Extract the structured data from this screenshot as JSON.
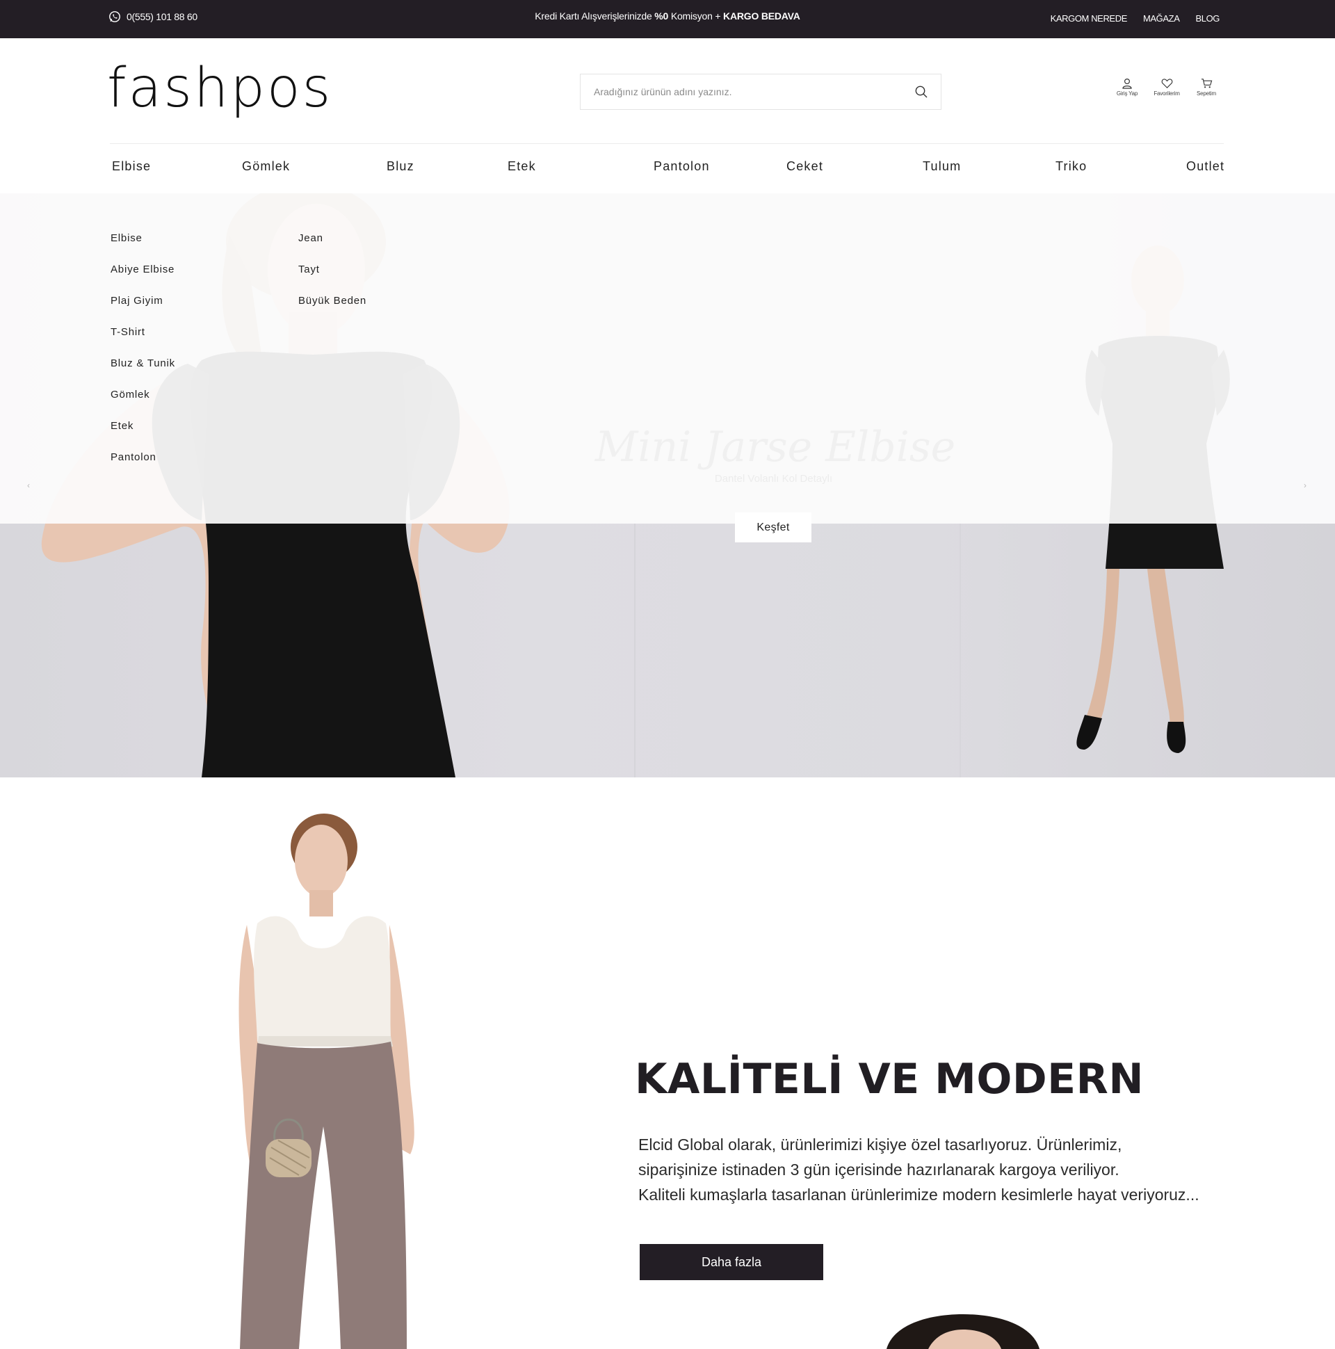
{
  "topbar": {
    "phone": "0(555) 101 88 60",
    "promo_prefix": "Kredi Kartı Alışverişlerinizde ",
    "promo_rate": "%0",
    "promo_mid": " Komisyon + ",
    "promo_cargo": "KARGO BEDAVA",
    "links": [
      "KARGOM NEREDE",
      "MAĞAZA",
      "BLOG"
    ]
  },
  "header": {
    "logo": "fashpos",
    "search_placeholder": "Aradığınız ürünün adını yazınız.",
    "user_links": [
      "Giriş Yap",
      "Favorilerim",
      "Sepetim"
    ]
  },
  "nav": [
    "Elbise",
    "Gömlek",
    "Bluz",
    "Etek",
    "Pantolon",
    "Ceket",
    "Tulum",
    "Triko",
    "Outlet"
  ],
  "dropdown": {
    "col1": [
      "Elbise",
      "Abiye Elbise",
      "Plaj Giyim",
      "T-Shirt",
      "Bluz & Tunik",
      "Gömlek",
      "Etek",
      "Pantolon"
    ],
    "col2": [
      "Jean",
      "Tayt",
      "Büyük Beden"
    ]
  },
  "hero": {
    "title": "Mini Jarse Elbise",
    "subtitle": "Dantel Volanlı Kol Detaylı",
    "cta": "Keşfet",
    "prev": "‹",
    "next": "›"
  },
  "about": {
    "title": "KALİTELİ VE MODERN",
    "lines": [
      "Elcid Global olarak, ürünlerimizi kişiye özel tasarlıyoruz. Ürünlerimiz,",
      "siparişinize istinaden 3 gün içerisinde hazırlanarak kargoya veriliyor.",
      "Kaliteli kumaşlarla tasarlanan ürünlerimize modern kesimlerle hayat veriyoruz..."
    ],
    "button": "Daha fazla"
  },
  "colors": {
    "dark": "#231e25",
    "hero_bg": "#dcdbe0",
    "white": "#ffffff"
  },
  "icons": [
    "whatsapp-icon",
    "search-icon",
    "user-icon",
    "heart-icon",
    "cart-icon"
  ]
}
